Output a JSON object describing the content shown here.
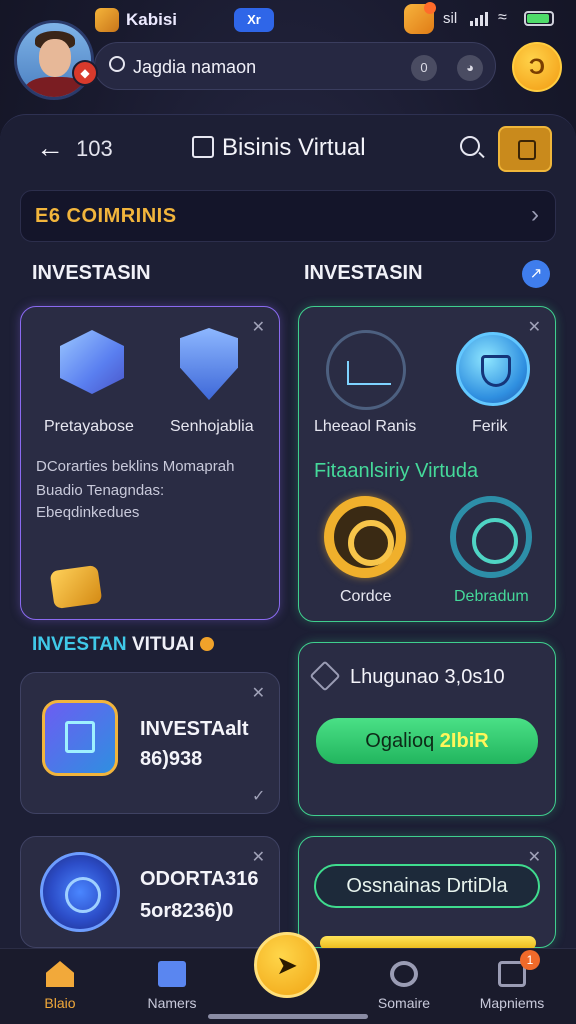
{
  "status": {
    "app_name": "Kabisi",
    "pill": "Xr",
    "signal_text": "sil",
    "tray_badge": "!"
  },
  "header": {
    "search_text": "Jagdia namaon",
    "btn1": "0",
    "coin_symbol": "Ɔ",
    "avatar_badge": "◆"
  },
  "nav": {
    "back": "←",
    "number": "103",
    "title": "Bisinis Virtual"
  },
  "banner": {
    "text": "E6 COIMRINIS",
    "chevron": "›"
  },
  "sections": {
    "left_title": "INVESTASIN",
    "right_title": "INVESTASIN",
    "info_icon": "↗"
  },
  "card_a": {
    "label1": "Pretayabose",
    "label2": "Senhojablia",
    "desc1": "DCorarties beklins Momaprah",
    "desc2": "Buadio Tenagndas:",
    "desc3": "Ebeqdinkedues"
  },
  "card_b": {
    "label1": "Lheeaol Ranis",
    "label2": "Ferik",
    "subtitle": "Fitaanlsiriy Virtuda",
    "label3": "Cordce",
    "label4": "Debradum"
  },
  "section2": {
    "title_a": "INVESTAN",
    "title_b": "VITUAI"
  },
  "card_c": {
    "line1": "INVESTAalt",
    "line2": "86)938",
    "check": "✓"
  },
  "card_d": {
    "headline": "Lhugunao 3,0s10",
    "button": "Ogalioq",
    "button_highlight": "2IbiR"
  },
  "card_e": {
    "line1": "ODORTA316",
    "line2": "5or8236)0"
  },
  "card_f": {
    "button": "Ossnainas DrtiDla"
  },
  "bottom_nav": {
    "tabs": [
      {
        "label": "Blaio"
      },
      {
        "label": "Namers"
      },
      {
        "label": "Somaire"
      },
      {
        "label": "Mapniems"
      }
    ],
    "fab_symbol": "➤",
    "badge": "1"
  },
  "colors": {
    "accent_gold": "#f2b53c",
    "accent_green": "#3fdc8e",
    "accent_blue": "#3f7dec",
    "background": "#17182a"
  }
}
